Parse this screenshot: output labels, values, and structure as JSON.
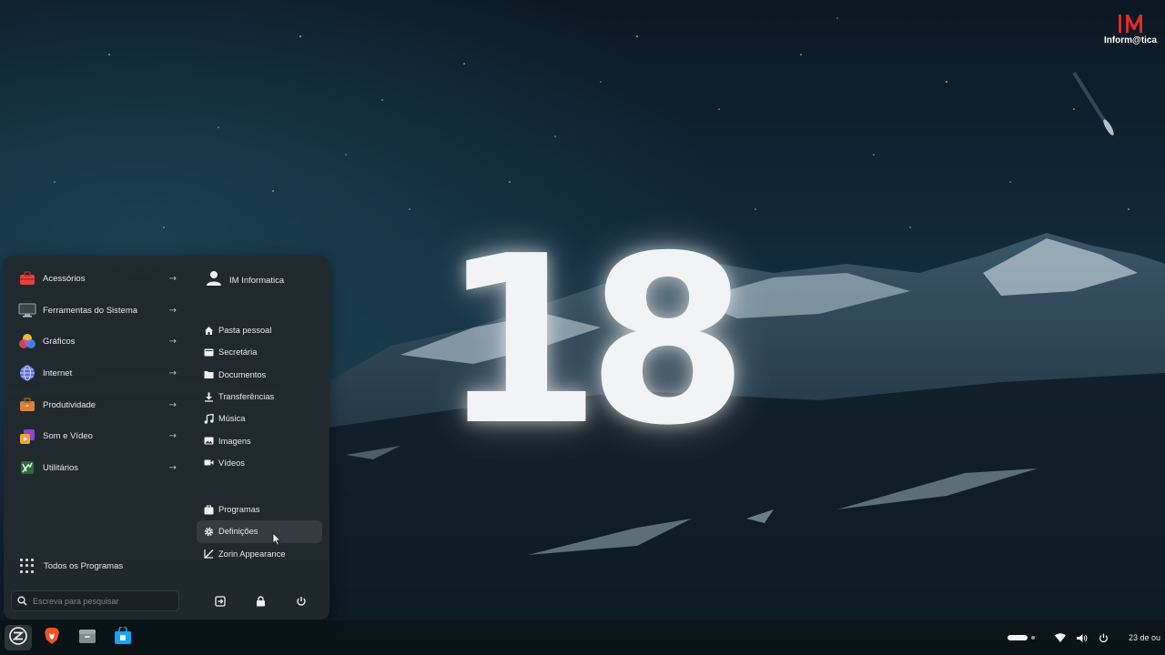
{
  "wallpaper": {
    "big_number": "18",
    "brand_letters": "IM",
    "brand_text": "Inform@tica"
  },
  "start_menu": {
    "categories": [
      {
        "label": "Acessórios",
        "icon": "toolbox-icon"
      },
      {
        "label": "Ferramentas do Sistema",
        "icon": "monitor-icon"
      },
      {
        "label": "Gráficos",
        "icon": "graphics-icon"
      },
      {
        "label": "Internet",
        "icon": "globe-icon"
      },
      {
        "label": "Produtividade",
        "icon": "briefcase-icon"
      },
      {
        "label": "Som e Vídeo",
        "icon": "multimedia-icon"
      },
      {
        "label": "Utilitários",
        "icon": "utilities-icon"
      }
    ],
    "arrow": "→",
    "all_programs_label": "Todos os Programas",
    "search_placeholder": "Escreva para pesquisar",
    "user_name": "IM Informatica",
    "places": [
      {
        "label": "Pasta pessoal",
        "icon": "home-icon"
      },
      {
        "label": "Secretária",
        "icon": "desktop-icon"
      },
      {
        "label": "Documentos",
        "icon": "folder-icon"
      },
      {
        "label": "Transferências",
        "icon": "download-icon"
      },
      {
        "label": "Música",
        "icon": "music-icon"
      },
      {
        "label": "Imagens",
        "icon": "image-icon"
      },
      {
        "label": "Vídeos",
        "icon": "video-icon"
      }
    ],
    "system": [
      {
        "label": "Programas",
        "icon": "software-icon"
      },
      {
        "label": "Definições",
        "icon": "gear-icon",
        "hovered": true
      },
      {
        "label": "Zorin Appearance",
        "icon": "appearance-icon"
      }
    ],
    "power_buttons": [
      "logout-icon",
      "lock-icon",
      "power-icon"
    ]
  },
  "taskbar": {
    "apps": [
      "zorin-menu-icon",
      "brave-icon",
      "files-icon",
      "software-store-icon"
    ],
    "clock": "23 de ou",
    "accent": "#15a6f0"
  }
}
